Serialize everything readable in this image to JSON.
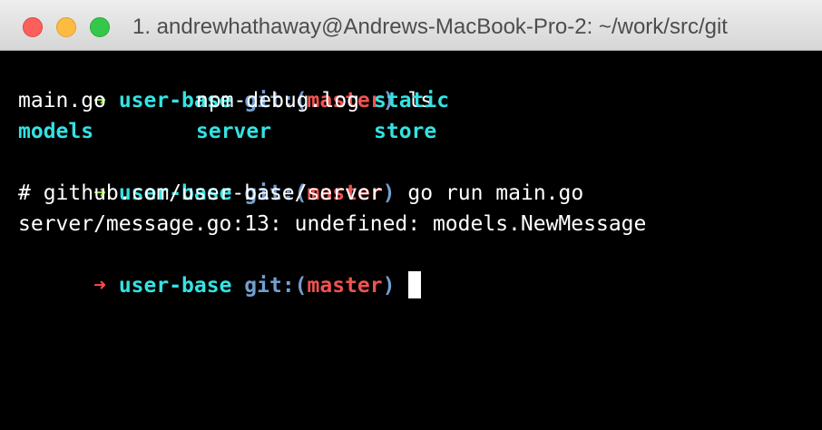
{
  "window": {
    "title": "1. andrewhathaway@Andrews-MacBook-Pro-2: ~/work/src/git"
  },
  "prompt": {
    "arrow": "➜",
    "dir": "user-base",
    "git_prefix": "git:(",
    "branch": "master",
    "git_suffix": ")"
  },
  "session": {
    "cmd1": "ls",
    "ls_row1": [
      "main.go",
      "npm-debug.log",
      "static"
    ],
    "ls_row2": [
      "models",
      "server",
      "store"
    ],
    "cmd2": "go run main.go",
    "out1": "# github.com/user-base/server",
    "out2": "server/message.go:13: undefined: models.NewMessage"
  },
  "colors": {
    "arrow_success": "#8ae234",
    "arrow_error": "#ff4a4a",
    "directory": "#34e2e2",
    "git_label": "#729fcf",
    "branch": "#ef5350"
  }
}
